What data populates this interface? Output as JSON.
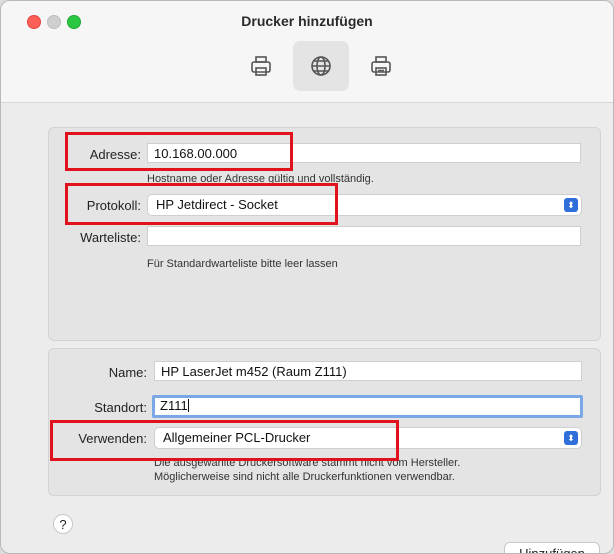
{
  "window": {
    "title": "Drucker hinzufügen"
  },
  "toolbar": {
    "items": [
      {
        "name": "Standard"
      },
      {
        "name": "IP"
      },
      {
        "name": "Windows"
      }
    ]
  },
  "network": {
    "address_label": "Adresse:",
    "address_value": "10.168.00.000",
    "address_hint": "Hostname oder Adresse gültig und vollständig.",
    "protocol_label": "Protokoll:",
    "protocol_value": "HP Jetdirect - Socket",
    "queue_label": "Warteliste:",
    "queue_value": "",
    "queue_hint": "Für Standardwarteliste bitte leer lassen"
  },
  "printer": {
    "name_label": "Name:",
    "name_value": "HP LaserJet m452 (Raum Z111)",
    "location_label": "Standort:",
    "location_value": "Z111",
    "use_label": "Verwenden:",
    "use_value": "Allgemeiner PCL-Drucker",
    "use_hint_line1": "Die ausgewählte Druckersoftware stammt nicht vom Hersteller.",
    "use_hint_line2": "Möglicherweise sind nicht alle Druckerfunktionen verwendbar."
  },
  "footer": {
    "help_label": "?",
    "add_button": "Hinzufügen"
  },
  "colors": {
    "accent": "#2f6fd9",
    "highlight": "#e0121d"
  }
}
